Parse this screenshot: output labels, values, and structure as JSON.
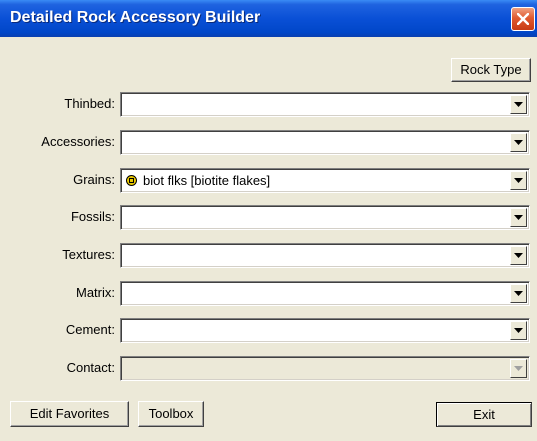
{
  "window": {
    "title": "Detailed Rock Accessory Builder",
    "close_icon": "close-icon"
  },
  "toolbar": {
    "rock_type_label": "Rock Type"
  },
  "fields": [
    {
      "key": "thinbed",
      "label": "Thinbed:",
      "value": "",
      "enabled": true
    },
    {
      "key": "accessories",
      "label": "Accessories:",
      "value": "",
      "enabled": true
    },
    {
      "key": "grains",
      "label": "Grains:",
      "value": "biot flks [biotite flakes]",
      "icon": "mineral-symbol-icon",
      "enabled": true
    },
    {
      "key": "fossils",
      "label": "Fossils:",
      "value": "",
      "enabled": true
    },
    {
      "key": "textures",
      "label": "Textures:",
      "value": "",
      "enabled": true
    },
    {
      "key": "matrix",
      "label": "Matrix:",
      "value": "",
      "enabled": true
    },
    {
      "key": "cement",
      "label": "Cement:",
      "value": "",
      "enabled": true
    },
    {
      "key": "contact",
      "label": "Contact:",
      "value": "",
      "enabled": false
    }
  ],
  "footer": {
    "edit_favorites_label": "Edit Favorites",
    "toolbox_label": "Toolbox",
    "exit_label": "Exit"
  },
  "colors": {
    "titlebar": "#0a50d6",
    "window_bg": "#ece9d8",
    "close_button": "#e05a30",
    "grain_icon": "#e8c800"
  }
}
